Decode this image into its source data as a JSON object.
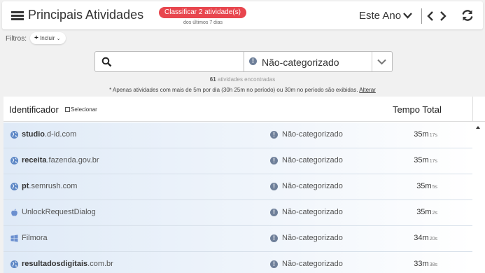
{
  "header": {
    "title": "Principais Atividades",
    "classify_label": "Classificar 2 atividade(s)",
    "classify_sub": "dos últimos 7 dias",
    "period": "Este Ano",
    "icons": {
      "menu": "list-icon",
      "period": "chevron-down-icon",
      "prev": "chevron-left-icon",
      "next": "chevron-right-icon",
      "refresh": "refresh-icon"
    }
  },
  "filters": {
    "label": "Filtros:",
    "include_label": "Incluir"
  },
  "search": {
    "value": "",
    "placeholder": "",
    "category_selected": "Não-categorizado"
  },
  "summary": {
    "count": "61",
    "count_label": "atividades encontradas",
    "note": "* Apenas atividades com mais de 5m por dia (30h 25m no período) ou 30m no período são exibidas.",
    "note_link": "Alterar"
  },
  "table": {
    "col_identifier": "Identificador",
    "select_label": "Selecionar",
    "col_total": "Tempo Total",
    "rows": [
      {
        "sub": "studio",
        "domain": ".d-id.com",
        "icon": "globe-icon",
        "category": "Não-categorizado",
        "time_main": "35m",
        "time_sec": "17s"
      },
      {
        "sub": "receita",
        "domain": ".fazenda.gov.br",
        "icon": "globe-icon",
        "category": "Não-categorizado",
        "time_main": "35m",
        "time_sec": "17s"
      },
      {
        "sub": "pt",
        "domain": ".semrush.com",
        "icon": "globe-icon",
        "category": "Não-categorizado",
        "time_main": "35m",
        "time_sec": "5s"
      },
      {
        "sub": "UnlockRequestDialog",
        "domain": "",
        "icon": "apple-icon",
        "category": "Não-categorizado",
        "time_main": "35m",
        "time_sec": "2s"
      },
      {
        "sub": "Filmora",
        "domain": "",
        "icon": "windows-icon",
        "category": "Não-categorizado",
        "time_main": "34m",
        "time_sec": "20s"
      },
      {
        "sub": "resultadosdigitais",
        "domain": ".com.br",
        "icon": "globe-icon",
        "category": "Não-categorizado",
        "time_main": "33m",
        "time_sec": "38s"
      }
    ]
  },
  "colors": {
    "accent_red": "#e8464e",
    "info_icon": "#6e7f99",
    "globe_icon": "#5b86c5"
  }
}
